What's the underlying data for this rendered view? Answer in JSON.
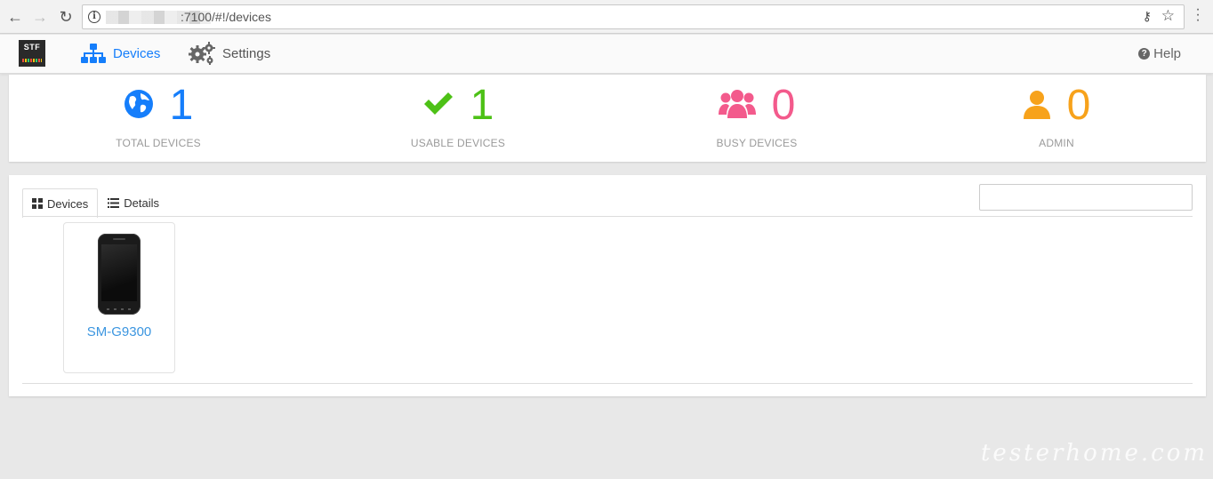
{
  "browser": {
    "url": ":7100/#!/devices"
  },
  "navbar": {
    "logo_text": "STF",
    "items": [
      {
        "label": "Devices",
        "icon": "sitemap-icon",
        "active": true
      },
      {
        "label": "Settings",
        "icon": "gears-icon",
        "active": false
      }
    ],
    "help_label": "Help"
  },
  "stats": [
    {
      "value": "1",
      "label": "TOTAL DEVICES",
      "icon": "globe-icon",
      "color": "#157efb"
    },
    {
      "value": "1",
      "label": "USABLE DEVICES",
      "icon": "check-icon",
      "color": "#4dc116"
    },
    {
      "value": "0",
      "label": "BUSY DEVICES",
      "icon": "users-icon",
      "color": "#f35a8c"
    },
    {
      "value": "0",
      "label": "ADMIN",
      "icon": "user-icon",
      "color": "#f7a21b"
    }
  ],
  "devices_panel": {
    "tabs": [
      {
        "label": "Devices",
        "icon": "grid-icon",
        "active": true
      },
      {
        "label": "Details",
        "icon": "list-icon",
        "active": false
      }
    ],
    "search_value": "",
    "devices": [
      {
        "name": "SM-G9300"
      }
    ]
  },
  "watermark": "testerhome.com"
}
